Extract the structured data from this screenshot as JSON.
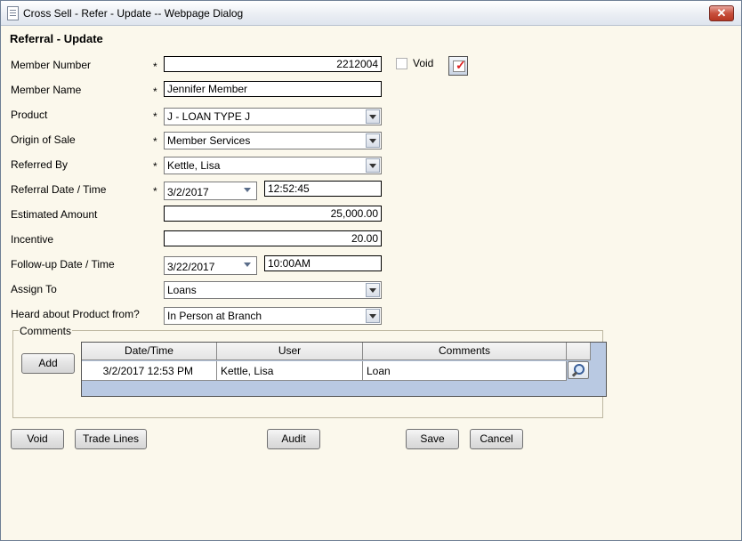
{
  "window": {
    "title": "Cross Sell - Refer - Update -- Webpage Dialog",
    "close_label": "✕"
  },
  "form": {
    "heading": "Referral - Update",
    "required_mark": "*",
    "member_number": {
      "label": "Member Number",
      "value": "2212004"
    },
    "void_checkbox": {
      "label": "Void",
      "checked": false
    },
    "member_name": {
      "label": "Member Name",
      "value": "Jennifer Member"
    },
    "product": {
      "label": "Product",
      "value": "J - LOAN TYPE J"
    },
    "origin_of_sale": {
      "label": "Origin of Sale",
      "value": "Member Services"
    },
    "referred_by": {
      "label": "Referred By",
      "value": "Kettle, Lisa"
    },
    "referral_date_time": {
      "label": "Referral Date / Time",
      "date": "3/2/2017",
      "time": "12:52:45"
    },
    "estimated_amount": {
      "label": "Estimated Amount",
      "value": "25,000.00"
    },
    "incentive": {
      "label": "Incentive",
      "value": "20.00"
    },
    "followup_date_time": {
      "label": "Follow-up Date / Time",
      "date": "3/22/2017",
      "time": "10:00AM"
    },
    "assign_to": {
      "label": "Assign To",
      "value": "Loans"
    },
    "heard_about": {
      "label": "Heard about Product from?",
      "value": "In Person at Branch"
    }
  },
  "comments": {
    "legend": "Comments",
    "add_label": "Add",
    "columns": [
      "Date/Time",
      "User",
      "Comments"
    ],
    "rows": [
      {
        "datetime": "3/2/2017 12:53 PM",
        "user": "Kettle, Lisa",
        "comment": "Loan"
      }
    ]
  },
  "buttons": {
    "void": "Void",
    "trade_lines": "Trade Lines",
    "audit": "Audit",
    "save": "Save",
    "cancel": "Cancel"
  },
  "colors": {
    "background": "#fbf8ec",
    "grid_background": "#b9c9e2"
  }
}
